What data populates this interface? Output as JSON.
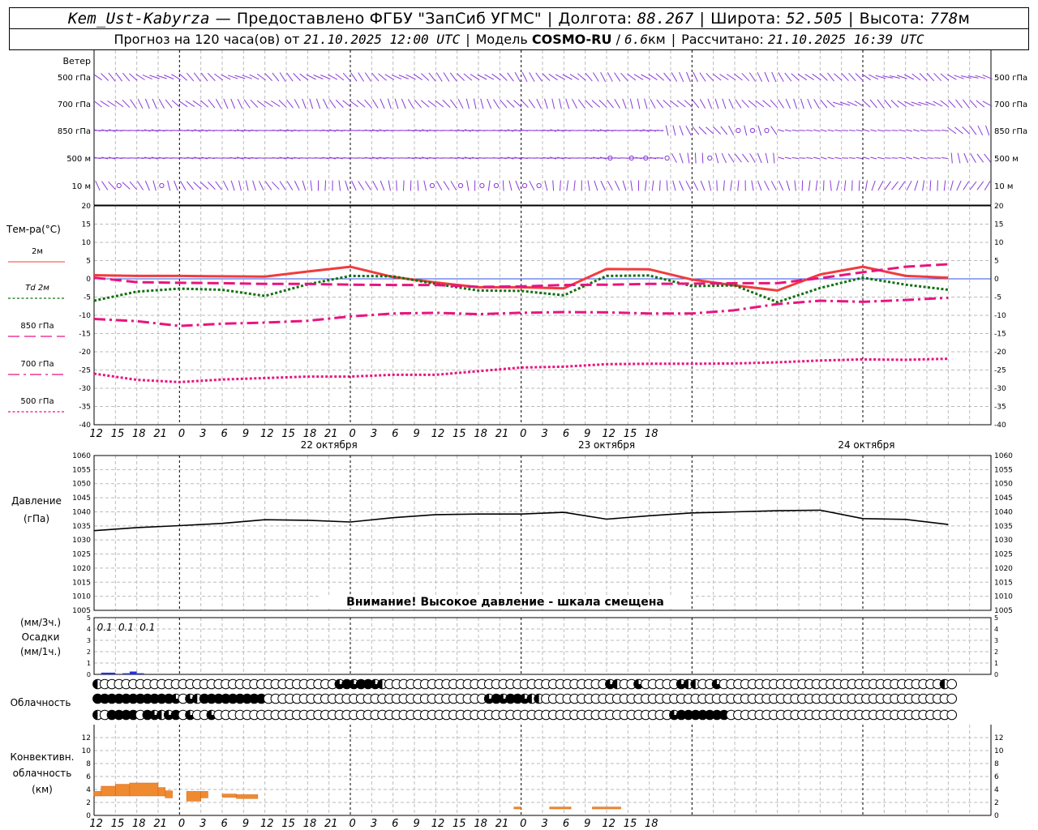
{
  "header": {
    "station": "Kem_Ust-Kabyrza",
    "provider": "Предоставлено ФГБУ \"ЗапСиб УГМС\"",
    "lon_label": "Долгота:",
    "lon": "88.267",
    "lat_label": "Широта:",
    "lat": "52.505",
    "alt_label": "Высота:",
    "alt": "778",
    "alt_unit": "м",
    "forecast_label": "Прогноз на 120 часа(ов)",
    "from_label": "от",
    "forecast_time": "21.10.2025 12:00 UTC",
    "model_label": "Модель",
    "model": "COSMO-RU",
    "resolution": "6.6",
    "res_unit": "км",
    "computed_label": "Рассчитано:",
    "computed_time": "21.10.2025 16:39 UTC"
  },
  "chart_data": [
    {
      "type": "wind_barbs",
      "title": "Ветер",
      "levels": [
        "500 гПа",
        "700 гПа",
        "850 гПа",
        "500 м",
        "10  м"
      ],
      "calm_marks": {
        "850 гПа": [
          90,
          92,
          94
        ],
        "500 м": [
          72,
          75,
          77,
          80,
          86
        ],
        "10  м": [
          3,
          9,
          47,
          51,
          54,
          56,
          60,
          62
        ]
      }
    },
    {
      "type": "line",
      "title": "Тем-ра(°C)",
      "x_hours": [
        0,
        6,
        12,
        18,
        24,
        30,
        36,
        42,
        48,
        54,
        60,
        66,
        72,
        78,
        84,
        90,
        96,
        102,
        108,
        114,
        120
      ],
      "x_tick_labels": [
        "12",
        "15",
        "18",
        "21",
        "0",
        "3",
        "6",
        "9",
        "12",
        "15",
        "18",
        "21",
        "0",
        "3",
        "6",
        "9",
        "12",
        "15",
        "18",
        "21",
        "0",
        "3",
        "6",
        "9",
        "12",
        "15",
        "18"
      ],
      "date_labels": [
        "22 октября",
        "23 октября",
        "24 октября"
      ],
      "ylim": [
        -40,
        20
      ],
      "yticks": [
        20,
        15,
        10,
        5,
        0,
        -5,
        -10,
        -15,
        -20,
        -25,
        -30,
        -35,
        -40
      ],
      "series": [
        {
          "name": "2м",
          "color": "#f03c3c",
          "style": "solid",
          "values": [
            1.0,
            0.8,
            0.8,
            0.7,
            0.6,
            2.0,
            3.3,
            0.5,
            -1.0,
            -2.3,
            -2.3,
            -2.6,
            2.7,
            2.6,
            -0.2,
            -1.8,
            -3.2,
            1.2,
            3.3,
            0.8,
            0.3
          ]
        },
        {
          "name": "Td  2м",
          "color": "#107010",
          "style": "dotted",
          "values": [
            -6.0,
            -3.5,
            -2.7,
            -3.0,
            -4.7,
            -1.5,
            0.8,
            0.7,
            -1.4,
            -3.2,
            -3.3,
            -4.5,
            0.8,
            0.9,
            -2.0,
            -1.8,
            -6.4,
            -2.5,
            0.3,
            -1.6,
            -3.0
          ]
        },
        {
          "name": "850 гПа",
          "color": "#e81480",
          "style": "longdash",
          "values": [
            0.3,
            -0.9,
            -1.1,
            -1.2,
            -1.4,
            -1.4,
            -1.6,
            -1.7,
            -1.7,
            -2.2,
            -2.1,
            -1.7,
            -1.6,
            -1.4,
            -1.3,
            -1.2,
            -1.2,
            0.2,
            1.8,
            3.3,
            4.0
          ]
        },
        {
          "name": "700 гПа",
          "color": "#e81480",
          "style": "dashdot",
          "values": [
            -11.0,
            -11.6,
            -12.9,
            -12.3,
            -12.0,
            -11.5,
            -10.3,
            -9.5,
            -9.3,
            -9.7,
            -9.3,
            -9.1,
            -9.2,
            -9.5,
            -9.5,
            -8.6,
            -6.9,
            -6.0,
            -6.3,
            -5.8,
            -5.2
          ]
        },
        {
          "name": "500 гПа",
          "color": "#e81480",
          "style": "dotted",
          "values": [
            -26.0,
            -27.7,
            -28.3,
            -27.6,
            -27.2,
            -26.8,
            -26.8,
            -26.3,
            -26.3,
            -25.3,
            -24.3,
            -24.1,
            -23.4,
            -23.3,
            -23.3,
            -23.2,
            -22.9,
            -22.4,
            -22.1,
            -22.2,
            -21.9
          ]
        }
      ]
    },
    {
      "type": "line",
      "title": "Давление",
      "ylabel": "(гПа)",
      "ylim": [
        1005,
        1060
      ],
      "yticks": [
        1060,
        1055,
        1050,
        1045,
        1040,
        1035,
        1030,
        1025,
        1020,
        1015,
        1010,
        1005
      ],
      "notice": "Внимание! Высокое давление - шкала смещена",
      "x_hours": [
        0,
        6,
        12,
        18,
        24,
        30,
        36,
        42,
        48,
        54,
        60,
        66,
        72,
        78,
        84,
        90,
        96,
        102,
        108,
        114,
        120
      ],
      "series": [
        {
          "name": "Давление",
          "color": "#000000",
          "values": [
            1033.3,
            1034.4,
            1035.1,
            1035.9,
            1037.2,
            1037.0,
            1036.4,
            1037.9,
            1039.0,
            1039.2,
            1039.2,
            1039.8,
            1037.4,
            1038.6,
            1039.6,
            1040.0,
            1040.4,
            1040.6,
            1037.6,
            1037.3,
            1035.5
          ]
        }
      ]
    },
    {
      "type": "bar",
      "title": "Осадки",
      "ylabel_top": "(мм/3ч.)",
      "ylabel_bottom": "(мм/1ч.)",
      "ylim": [
        0,
        5
      ],
      "yticks": [
        5,
        4,
        3,
        2,
        1,
        0
      ],
      "labels": [
        {
          "hour": 1.5,
          "text": "0.1"
        },
        {
          "hour": 4.5,
          "text": "0.1"
        },
        {
          "hour": 7.5,
          "text": "0.1"
        }
      ],
      "bars": [
        {
          "x_from": 1,
          "x_to": 3,
          "value": 0.15
        },
        {
          "x_from": 4,
          "x_to": 5,
          "value": 0.1
        },
        {
          "x_from": 5,
          "x_to": 6,
          "value": 0.25
        },
        {
          "x_from": 6,
          "x_to": 7,
          "value": 0.1
        }
      ]
    },
    {
      "type": "table",
      "title": "Облачность",
      "rows": [
        "1000000000000000000000000000000000232332100000000000000000000000000000002100200000211002000000000000000000000000000000010",
        "3333333333320213333333330000000000000000000000000000000232332110000000000000000000000000000000000000000000000000000000000",
        "1033330321230200200000000000000000000000000000000000000000000000000000000000000002333333300000000000000000000000000000000"
      ]
    },
    {
      "type": "bar",
      "title": "Конвективн. облачность",
      "ylabel": "(км)",
      "ylim": [
        0,
        14
      ],
      "yticks": [
        12,
        10,
        8,
        6,
        4,
        2,
        0
      ],
      "bars": [
        {
          "x_from": 0,
          "x_to": 1,
          "bottom": 3.0,
          "top": 3.7,
          "color": "#f08a30"
        },
        {
          "x_from": 1,
          "x_to": 3,
          "bottom": 3.0,
          "top": 4.5,
          "color": "#f08a30"
        },
        {
          "x_from": 3,
          "x_to": 5,
          "bottom": 3.0,
          "top": 4.8,
          "color": "#f08a30"
        },
        {
          "x_from": 5,
          "x_to": 9,
          "bottom": 3.0,
          "top": 5.0,
          "color": "#f08a30"
        },
        {
          "x_from": 9,
          "x_to": 10,
          "bottom": 3.0,
          "top": 4.3,
          "color": "#f08a30"
        },
        {
          "x_from": 10,
          "x_to": 11,
          "bottom": 2.7,
          "top": 3.8,
          "color": "#f08a30"
        },
        {
          "x_from": 13,
          "x_to": 15,
          "bottom": 2.2,
          "top": 3.7,
          "color": "#f08a30"
        },
        {
          "x_from": 15,
          "x_to": 16,
          "bottom": 2.7,
          "top": 3.7,
          "color": "#f08a30"
        },
        {
          "x_from": 18,
          "x_to": 20,
          "bottom": 2.8,
          "top": 3.3,
          "color": "#f08a30"
        },
        {
          "x_from": 20,
          "x_to": 23,
          "bottom": 2.6,
          "top": 3.2,
          "color": "#f08a30"
        },
        {
          "x_from": 59,
          "x_to": 60,
          "bottom": 1.0,
          "top": 1.3,
          "color": "#f08a30"
        },
        {
          "x_from": 64,
          "x_to": 67,
          "bottom": 1.0,
          "top": 1.3,
          "color": "#f08a30"
        },
        {
          "x_from": 70,
          "x_to": 74,
          "bottom": 1.0,
          "top": 1.3,
          "color": "#f08a30"
        }
      ]
    }
  ]
}
